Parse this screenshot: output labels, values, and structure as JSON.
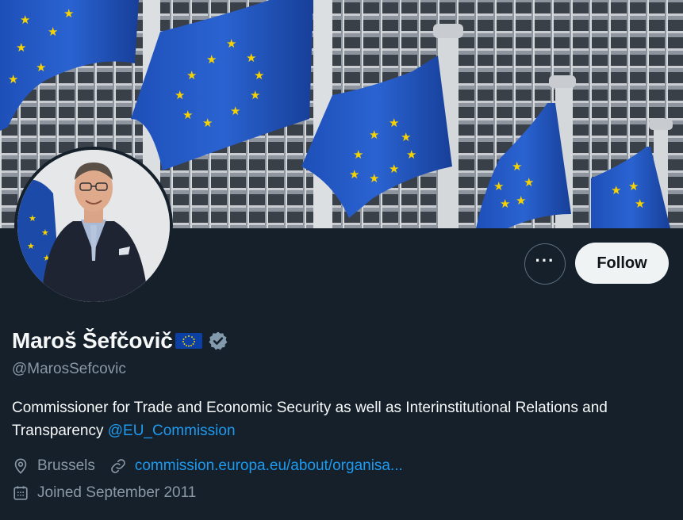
{
  "profile": {
    "display_name": "Maroš Šefčovič",
    "flag_icon": "eu-flag-icon",
    "verified_icon": "verified-badge-icon",
    "handle": "@MarosSefcovic",
    "bio_text": "Commissioner for Trade and Economic Security as well as Interinstitutional Relations and Transparency ",
    "bio_mention": "@EU_Commission",
    "location": "Brussels",
    "website": "commission.europa.eu/about/organisa...",
    "joined": "Joined September 2011"
  },
  "actions": {
    "more_label": "···",
    "follow_label": "Follow"
  },
  "colors": {
    "background": "#15202b",
    "link": "#1d9bf0",
    "secondary_text": "#8b98a5",
    "follow_bg": "#eff3f4",
    "eu_blue": "#0b3fa3",
    "eu_star": "#f6d200"
  }
}
